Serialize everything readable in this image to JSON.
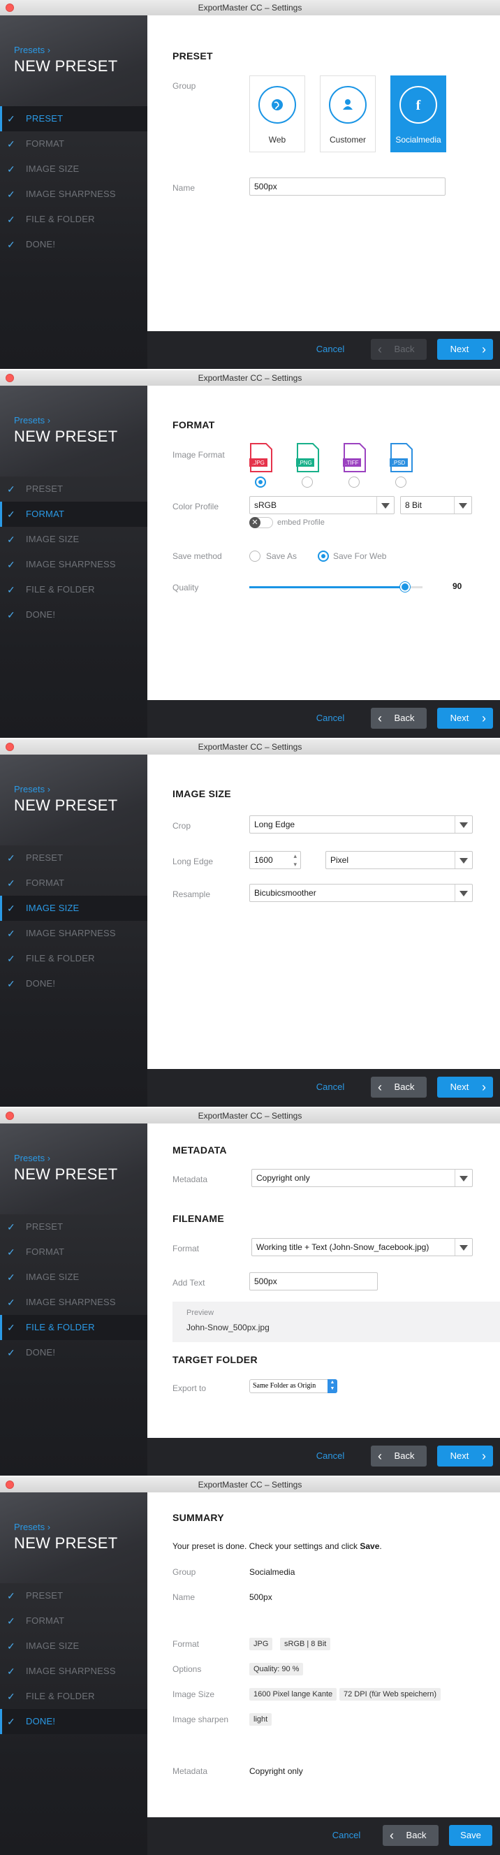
{
  "app": {
    "window_title": "ExportMaster CC – Settings"
  },
  "sidebar": {
    "crumb": "Presets",
    "title": "NEW PRESET",
    "steps": [
      "PRESET",
      "FORMAT",
      "IMAGE SIZE",
      "IMAGE SHARPNESS",
      "FILE & FOLDER",
      "DONE!"
    ]
  },
  "footer": {
    "cancel": "Cancel",
    "back": "Back",
    "next": "Next",
    "save": "Save"
  },
  "preset": {
    "section": "PRESET",
    "group_label": "Group",
    "groups": [
      {
        "label": "Web",
        "icon": "globe-icon"
      },
      {
        "label": "Customer",
        "icon": "person-icon"
      },
      {
        "label": "Socialmedia",
        "icon": "facebook-icon"
      }
    ],
    "name_label": "Name",
    "name_value": "500px"
  },
  "format": {
    "section": "FORMAT",
    "image_format_label": "Image Format",
    "formats": [
      {
        "label": ".JPG",
        "color": "#e5334b"
      },
      {
        "label": ".PNG",
        "color": "#18b08a"
      },
      {
        "label": ".TIFF",
        "color": "#9b42c0"
      },
      {
        "label": ".PSD",
        "color": "#2b8fe0"
      }
    ],
    "color_profile_label": "Color Profile",
    "color_profile_value": "sRGB",
    "bit_depth_value": "8 Bit",
    "embed_profile_label": "embed Profile",
    "save_method_label": "Save method",
    "save_as_label": "Save As",
    "save_for_web_label": "Save For Web",
    "quality_label": "Quality",
    "quality_value": "90",
    "quality_fraction": 0.9
  },
  "image_size": {
    "section": "IMAGE SIZE",
    "crop_label": "Crop",
    "crop_value": "Long Edge",
    "long_edge_label": "Long Edge",
    "long_edge_value": "1600",
    "unit_value": "Pixel",
    "resample_label": "Resample",
    "resample_value": "Bicubicsmoother"
  },
  "file_folder": {
    "metadata_section": "METADATA",
    "metadata_label": "Metadata",
    "metadata_value": "Copyright only",
    "filename_section": "FILENAME",
    "format_label": "Format",
    "format_value": "Working title + Text (John-Snow_facebook.jpg)",
    "add_text_label": "Add Text",
    "add_text_value": "500px",
    "preview_label": "Preview",
    "preview_value": "John-Snow_500px.jpg",
    "target_section": "TARGET FOLDER",
    "export_to_label": "Export to",
    "export_to_value": "Same Folder as Origin"
  },
  "summary": {
    "section": "SUMMARY",
    "intro_text": "Your preset is done. Check your settings and click ",
    "intro_bold": "Save",
    "intro_end": ".",
    "group_label": "Group",
    "group_value": "Socialmedia",
    "name_label": "Name",
    "name_value": "500px",
    "format_label": "Format",
    "format_chips": [
      "JPG",
      "sRGB | 8 Bit"
    ],
    "options_label": "Options",
    "options_chips": [
      "Quality: 90 %"
    ],
    "image_size_label": "Image Size",
    "image_size_chips": [
      "1600 Pixel lange Kante",
      "72 DPI (für Web speichern)"
    ],
    "sharpen_label": "Image sharpen",
    "sharpen_chips": [
      "light"
    ],
    "metadata_label": "Metadata",
    "metadata_value": "Copyright only"
  }
}
